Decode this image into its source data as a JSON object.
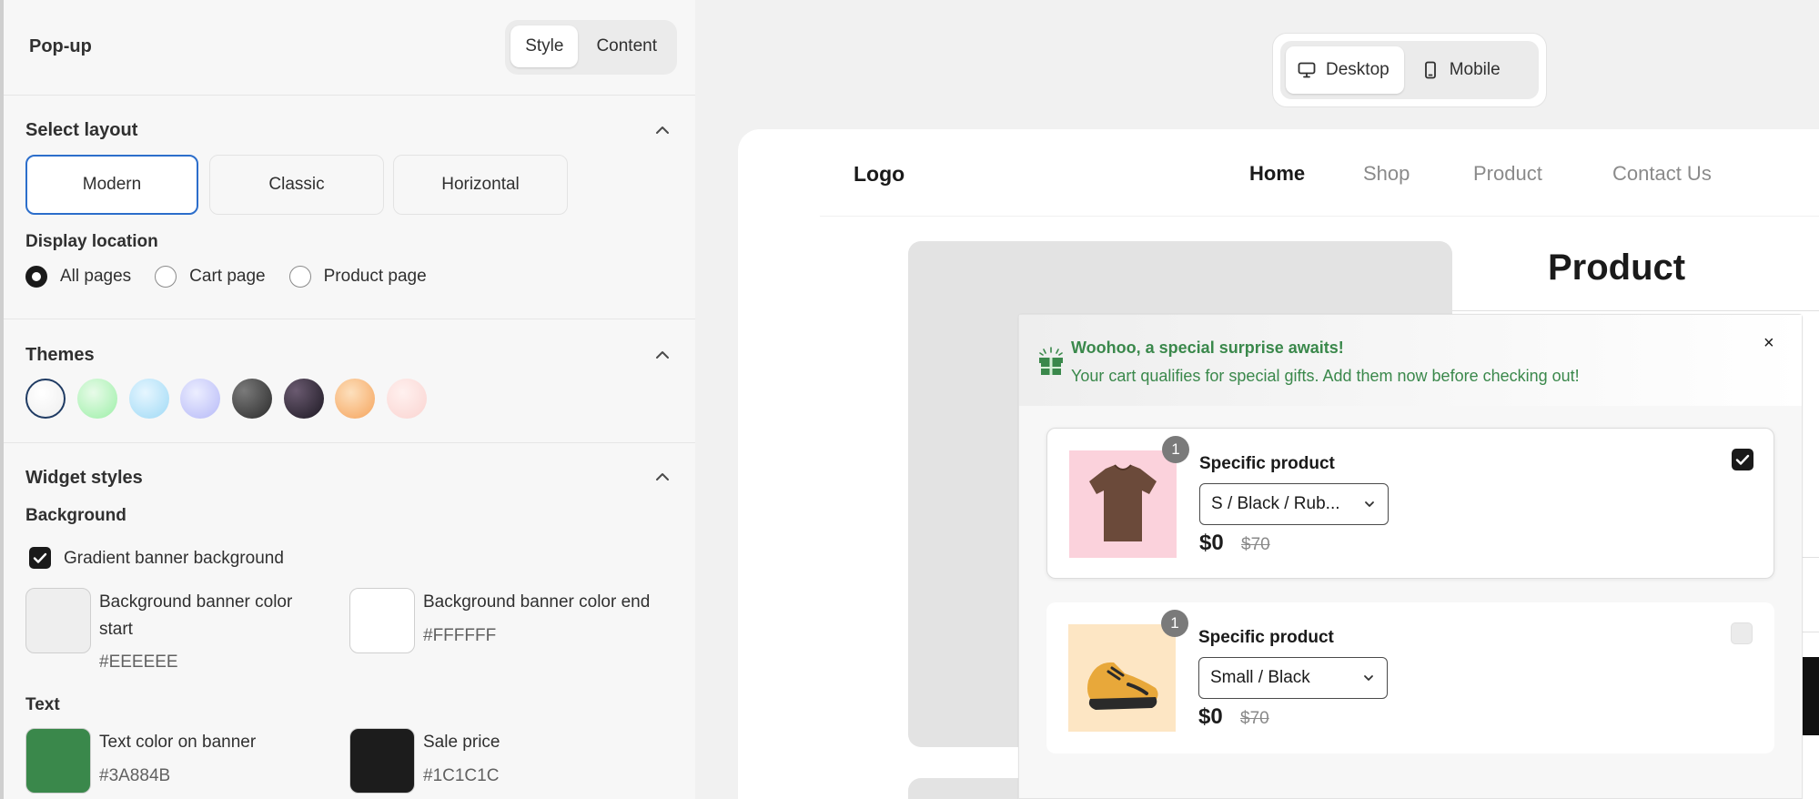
{
  "panel": {
    "title": "Pop-up",
    "tabs": [
      {
        "label": "Style"
      },
      {
        "label": "Content"
      }
    ],
    "layout": {
      "title": "Select layout",
      "options": [
        "Modern",
        "Classic",
        "Horizontal"
      ],
      "selected": "Modern"
    },
    "display_location": {
      "title": "Display location",
      "options": [
        "All pages",
        "Cart page",
        "Product page"
      ],
      "selected": "All pages"
    },
    "themes": {
      "title": "Themes",
      "swatches": [
        "#EEEEEE",
        "#9BEFA6",
        "#9ED9F5",
        "#B5B8F7",
        "#3A3A3A",
        "#2A2430",
        "#F5A35B",
        "#FAD3D0"
      ]
    },
    "widget_styles": {
      "title": "Widget styles",
      "background_label": "Background",
      "gradient_checkbox": "Gradient banner background",
      "bg_start_label": "Background banner color start",
      "bg_start_value": "#EEEEEE",
      "bg_end_label": "Background banner color end",
      "bg_end_value": "#FFFFFF",
      "text_label": "Text",
      "text_color_label": "Text color on banner",
      "text_color_value": "#3A884B",
      "sale_price_label": "Sale price",
      "sale_price_value": "#1C1C1C"
    }
  },
  "preview": {
    "device_tabs": [
      {
        "label": "Desktop"
      },
      {
        "label": "Mobile"
      }
    ],
    "store": {
      "logo": "Logo",
      "nav": [
        "Home",
        "Shop",
        "Product",
        "Contact Us"
      ],
      "product_title": "Product"
    },
    "popup": {
      "title": "Woohoo, a special surprise awaits!",
      "subtitle": "Your cart qualifies for special gifts. Add them now before checking out!",
      "close": "×",
      "items": [
        {
          "name": "Specific product",
          "quantity": "1",
          "variant": "S / Black / Rub...",
          "price": "$0",
          "compare_price": "$70",
          "checked": true
        },
        {
          "name": "Specific product",
          "quantity": "1",
          "variant": "Small / Black",
          "price": "$0",
          "compare_price": "$70",
          "checked": false
        }
      ]
    }
  }
}
